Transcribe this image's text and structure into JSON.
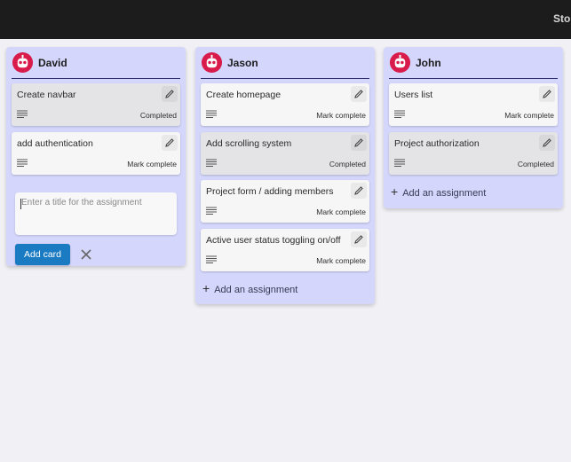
{
  "topbar": {
    "link": "Stor"
  },
  "columns": [
    {
      "name": "David",
      "cards": [
        {
          "title": "Create navbar",
          "status": "Completed",
          "done": true
        },
        {
          "title": "add authentication",
          "status": "Mark complete",
          "done": false
        }
      ],
      "new_card": {
        "placeholder": "Enter a title for the assignment",
        "add_label": "Add card"
      }
    },
    {
      "name": "Jason",
      "cards": [
        {
          "title": "Create homepage",
          "status": "Mark complete",
          "done": false
        },
        {
          "title": "Add scrolling system",
          "status": "Completed",
          "done": true
        },
        {
          "title": "Project form / adding members",
          "status": "Mark complete",
          "done": false
        },
        {
          "title": "Active user status toggling on/off",
          "status": "Mark complete",
          "done": false
        }
      ],
      "add_label": "Add an assignment"
    },
    {
      "name": "John",
      "cards": [
        {
          "title": "Users list",
          "status": "Mark complete",
          "done": false
        },
        {
          "title": "Project authorization",
          "status": "Completed",
          "done": true
        }
      ],
      "add_label": "Add an assignment"
    }
  ],
  "colors": {
    "column_bg": "#d4d6fb",
    "accent": "#1a7ac2",
    "avatar": "#d81b4a"
  },
  "icons": {
    "avatar": "robot-avatar-icon",
    "edit": "pencil-icon",
    "description": "description-lines-icon",
    "add": "plus-icon",
    "close": "close-icon"
  }
}
